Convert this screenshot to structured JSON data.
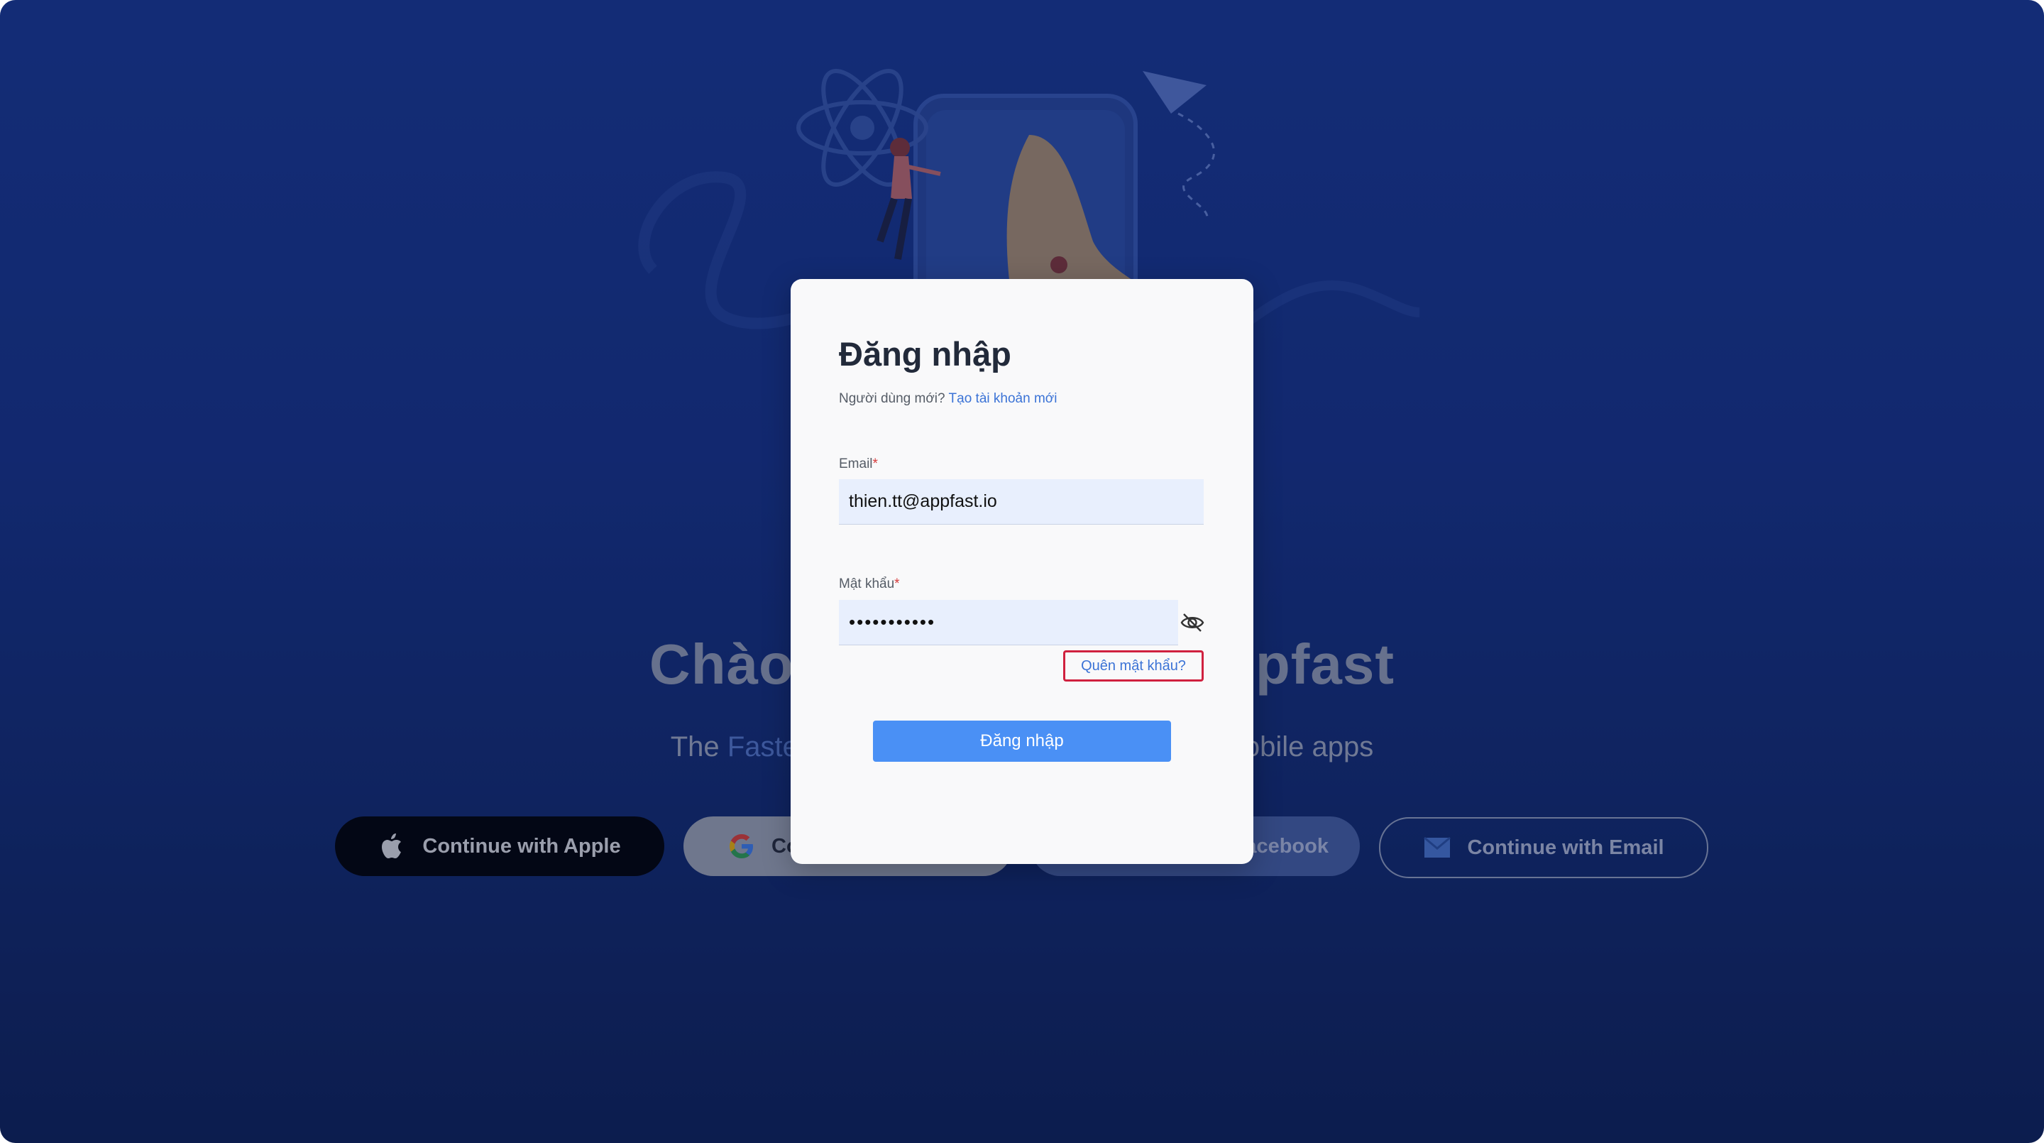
{
  "hero": {
    "title_left": "Chào",
    "title_right": "pfast",
    "subtitle_prefix": "The",
    "subtitle_accent": "Faste",
    "subtitle_suffix": "obile apps"
  },
  "social": {
    "apple_label": "Continue with Apple",
    "google_label": "Co",
    "facebook_label": "acebook",
    "email_label": "Continue with Email"
  },
  "login": {
    "title": "Đăng nhập",
    "new_user_text": "Người dùng mới?",
    "create_account_link": "Tạo tài khoản mới",
    "email_label": "Email",
    "email_value": "thien.tt@appfast.io",
    "password_label": "Mật khẩu",
    "password_value": "•••••••••••",
    "required_mark": "*",
    "forgot_password": "Quên mật khẩu?",
    "submit_label": "Đăng nhập"
  },
  "colors": {
    "accent": "#4a90f5",
    "link": "#3b73d6",
    "highlight_border": "#d0213f",
    "background": "#17348a"
  },
  "icons": [
    "apple-icon",
    "google-icon",
    "email-icon",
    "eye-off-icon"
  ]
}
